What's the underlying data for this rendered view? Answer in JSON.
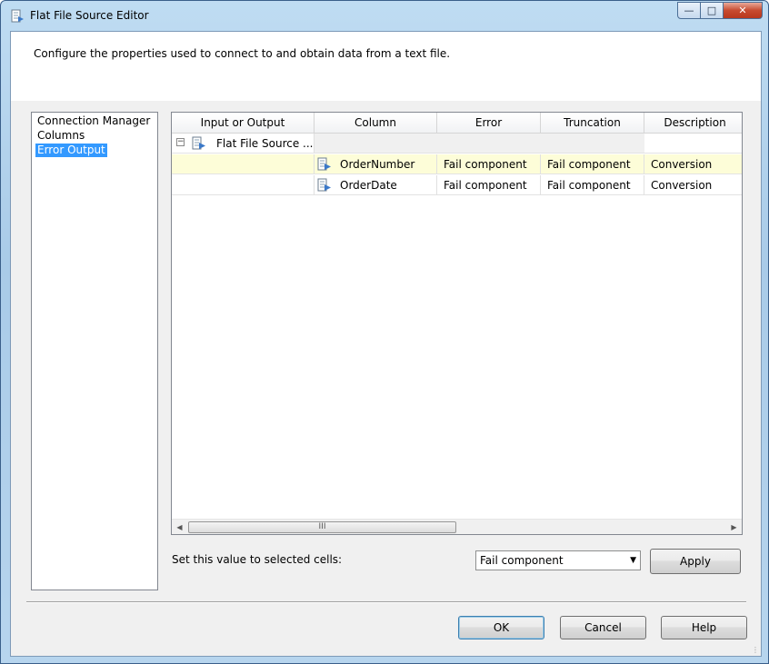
{
  "window": {
    "title": "Flat File Source Editor"
  },
  "header": {
    "description": "Configure the properties used to connect to and obtain data from a text file."
  },
  "nav": {
    "items": [
      {
        "label": "Connection Manager",
        "selected": false
      },
      {
        "label": "Columns",
        "selected": false
      },
      {
        "label": "Error Output",
        "selected": true
      }
    ]
  },
  "grid": {
    "columns": [
      "Input or Output",
      "Column",
      "Error",
      "Truncation",
      "Description"
    ],
    "group_row": {
      "label": "Flat File Source ...",
      "expander": "−"
    },
    "rows": [
      {
        "column": "OrderNumber",
        "error": "Fail component",
        "truncation": "Fail component",
        "description": "Conversion"
      },
      {
        "column": "OrderDate",
        "error": "Fail component",
        "truncation": "Fail component",
        "description": "Conversion"
      }
    ],
    "scroll_thumb": "III"
  },
  "footer": {
    "set_value_label": "Set this value to selected cells:",
    "selected_value": "Fail component",
    "apply_label": "Apply",
    "ok_label": "OK",
    "cancel_label": "Cancel",
    "help_label": "Help"
  },
  "colors": {
    "selection": "#3399ff",
    "highlight_row": "#fdfdd8",
    "close_button": "#c74a2f"
  }
}
